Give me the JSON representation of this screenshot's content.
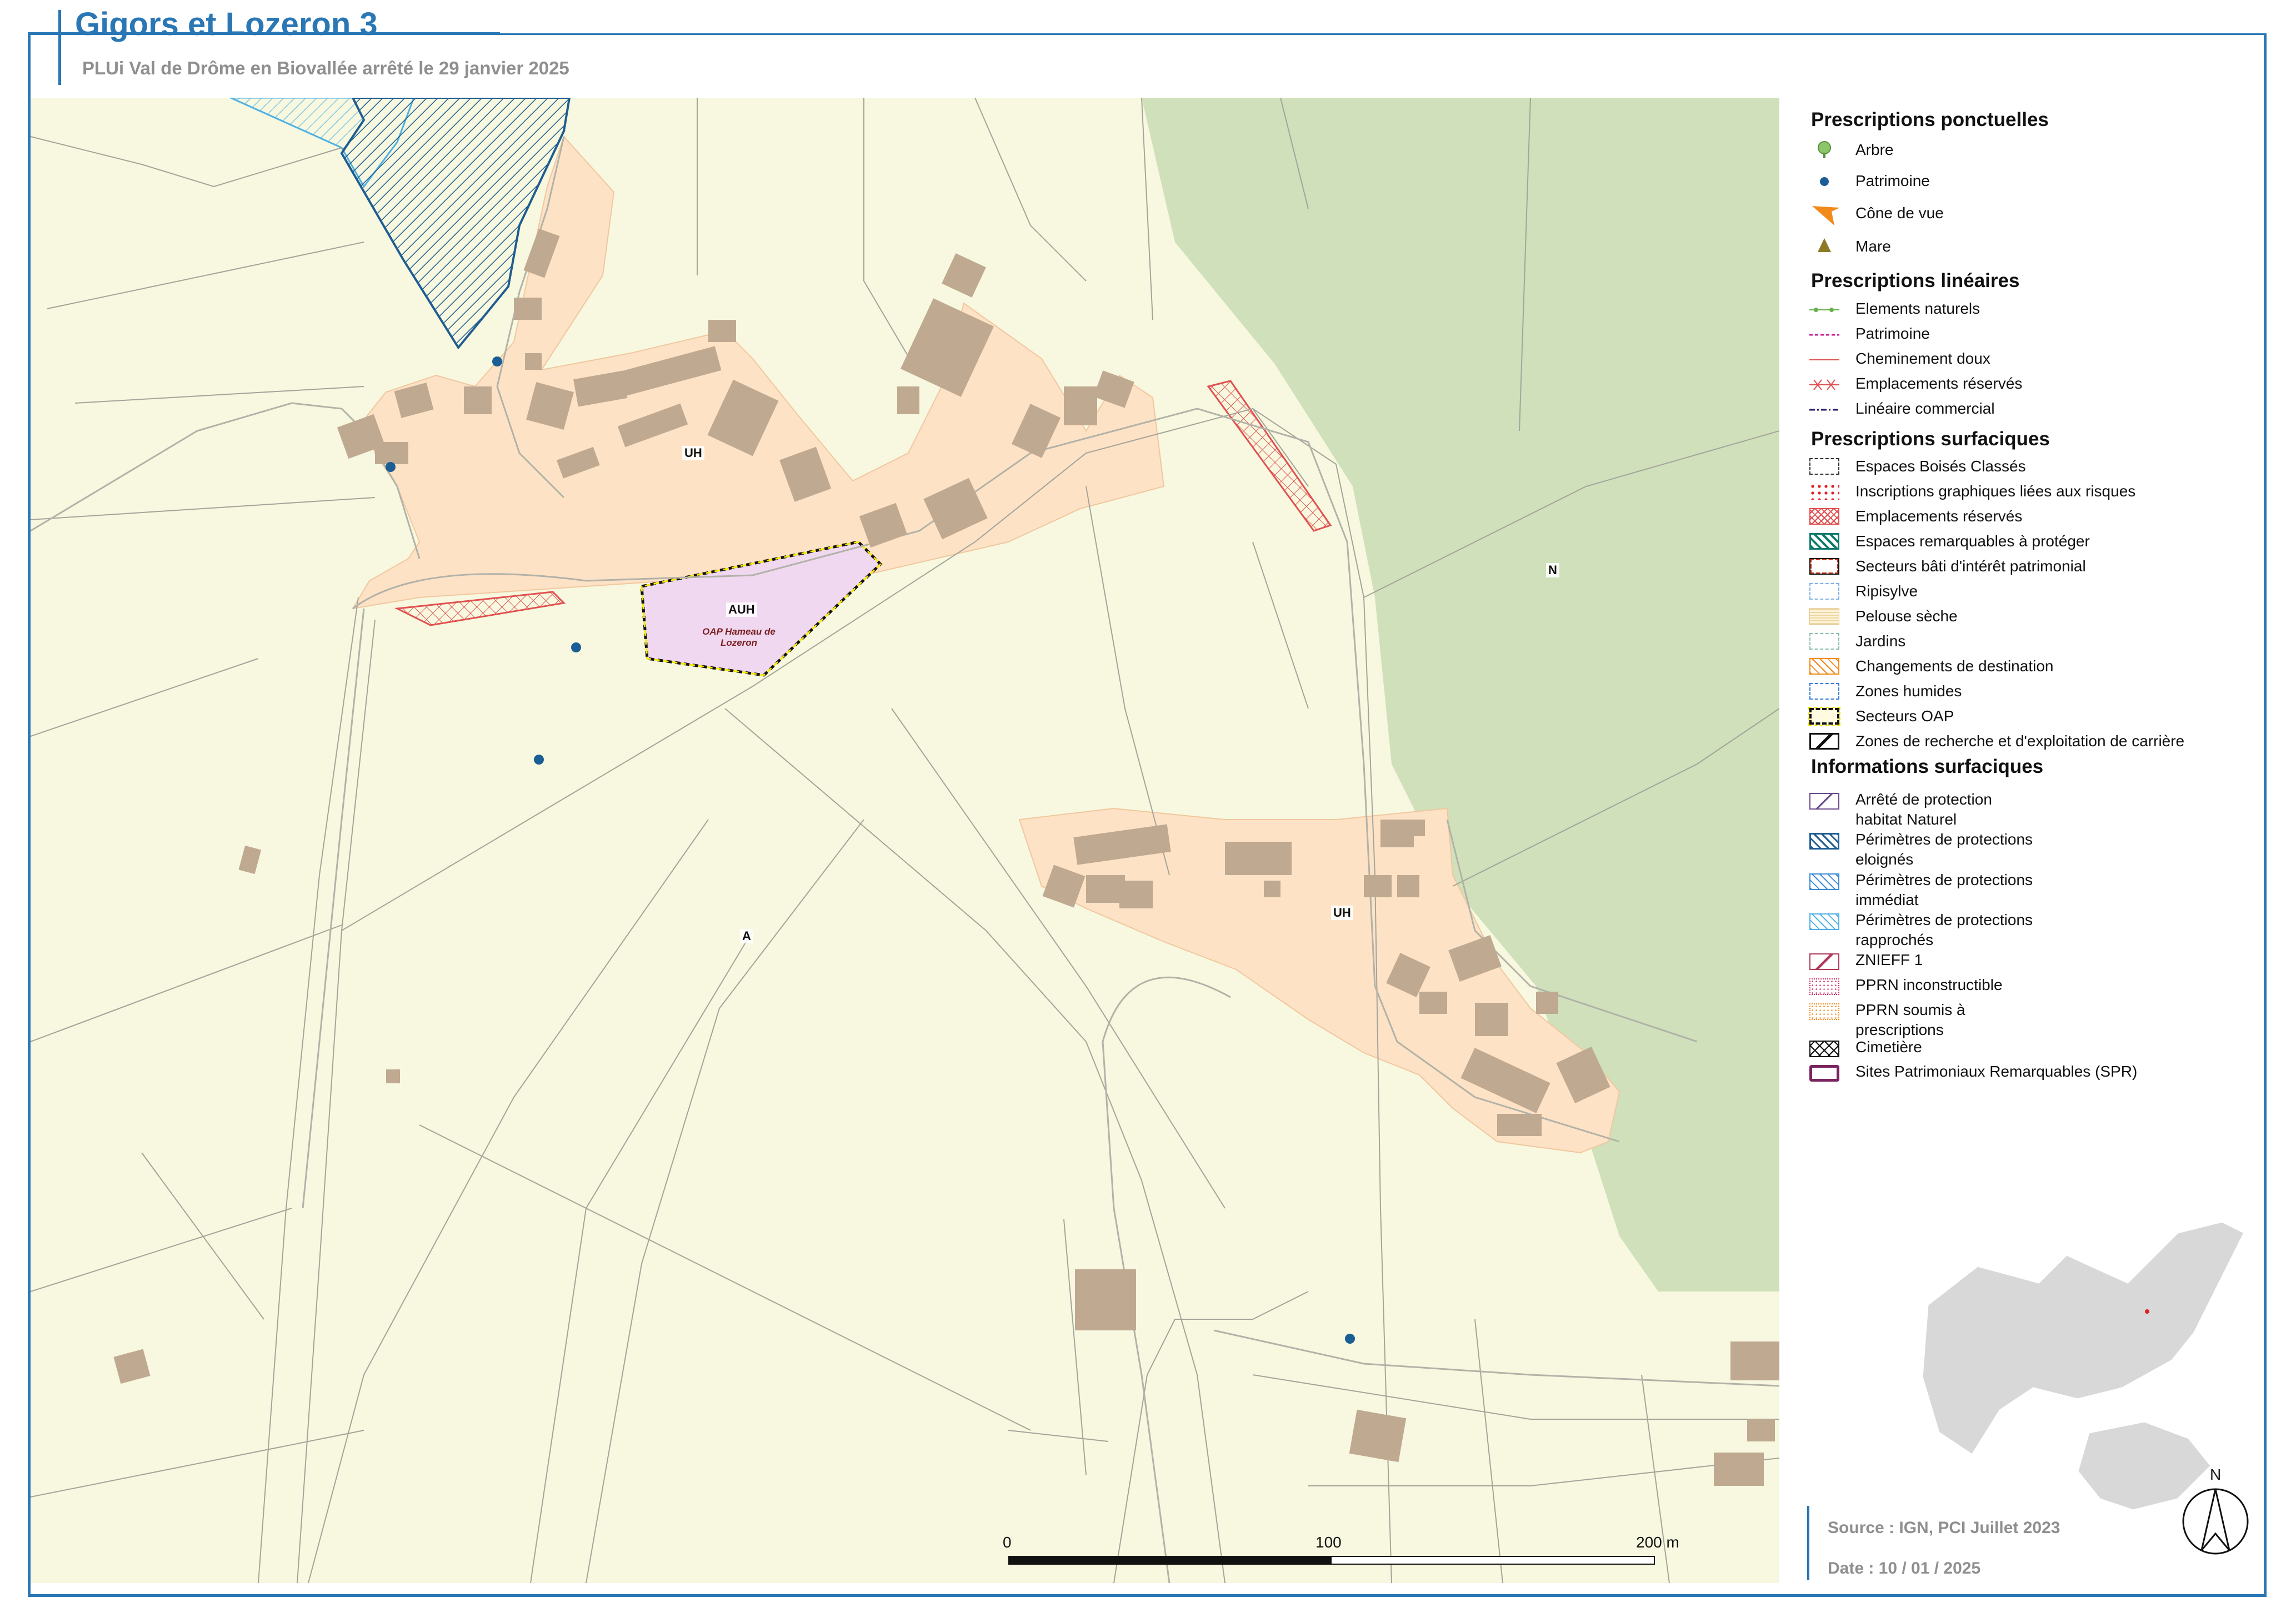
{
  "header": {
    "title": "Gigors et Lozeron 3",
    "subtitle": "PLUi Val de Drôme en Biovallée arrêté le 29 janvier 2025"
  },
  "map": {
    "zones": [
      "UH",
      "UH",
      "AUH",
      "A",
      "N"
    ],
    "oap_label": "OAP Hameau de Lozeron",
    "scale": {
      "ticks": [
        "0",
        "100",
        "200 m"
      ]
    },
    "colors": {
      "agricole": "#f7f8df",
      "urbain": "#fde2c5",
      "naturel": "#cfe0ba",
      "auh": "#f0d8f1",
      "bati": "#bfa991",
      "frame": "#2a77b5"
    }
  },
  "legend": {
    "ponctuelles": {
      "title": "Prescriptions ponctuelles",
      "items": [
        {
          "label": "Arbre",
          "icon": "tree-icon"
        },
        {
          "label": "Patrimoine",
          "icon": "dot-icon"
        },
        {
          "label": "Cône de vue",
          "icon": "cone-icon"
        },
        {
          "label": "Mare",
          "icon": "triangle-icon"
        }
      ]
    },
    "lineaires": {
      "title": "Prescriptions linéaires",
      "items": [
        "Elements naturels",
        "Patrimoine",
        "Cheminement doux",
        "Emplacements réservés",
        "Linéaire commercial"
      ]
    },
    "surfaciques": {
      "title": "Prescriptions surfaciques",
      "items": [
        "Espaces Boisés Classés",
        "Inscriptions graphiques liées aux risques",
        "Emplacements réservés",
        "Espaces remarquables à protéger",
        "Secteurs bâti d'intérêt patrimonial",
        "Ripisylve",
        "Pelouse sèche",
        "Jardins",
        "Changements de destination",
        "Zones humides",
        "Secteurs OAP",
        "Zones de recherche et d'exploitation de carrière"
      ]
    },
    "informations": {
      "title": "Informations surfaciques",
      "items": [
        "Arrêté de protection habitat Naturel",
        "Périmètres de protections eloignés",
        "Périmètres de protections immédiat",
        "Périmètres de protections rapprochés",
        "ZNIEFF 1",
        "PPRN inconstructible",
        "PPRN soumis à prescriptions",
        "Cimetière",
        "Sites Patrimoniaux Remarquables (SPR)"
      ]
    }
  },
  "footer": {
    "source": "Source : IGN, PCI Juillet 2023",
    "date": "Date : 10 / 01 / 2025",
    "north": "N"
  }
}
